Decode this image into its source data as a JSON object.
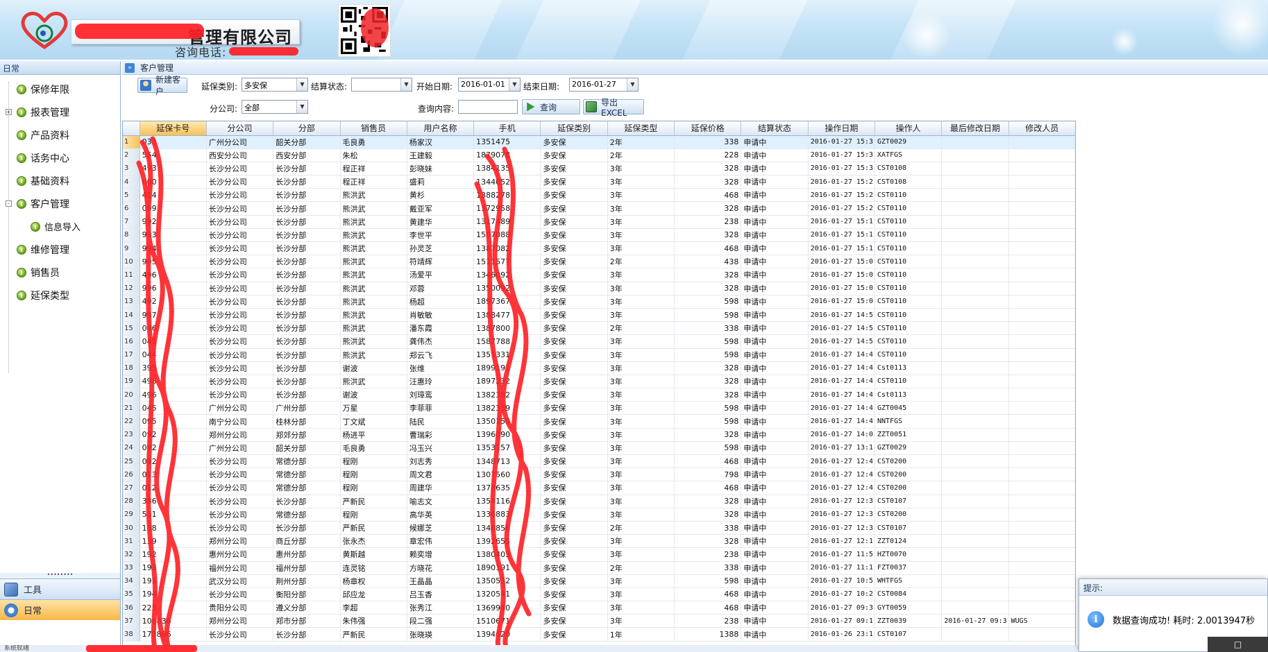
{
  "banner": {
    "company_name": "管理有限公司",
    "hotline_label": "咨询电话:"
  },
  "sidebar": {
    "header": "日常",
    "items": [
      {
        "label": "保修年限",
        "child": false,
        "expander": ""
      },
      {
        "label": "报表管理",
        "child": false,
        "expander": "+"
      },
      {
        "label": "产品资料",
        "child": false,
        "expander": ""
      },
      {
        "label": "话务中心",
        "child": false,
        "expander": ""
      },
      {
        "label": "基础资料",
        "child": false,
        "expander": ""
      },
      {
        "label": "客户管理",
        "child": false,
        "expander": "-"
      },
      {
        "label": "信息导入",
        "child": true,
        "expander": ""
      },
      {
        "label": "维修管理",
        "child": false,
        "expander": ""
      },
      {
        "label": "销售员",
        "child": false,
        "expander": ""
      },
      {
        "label": "延保类型",
        "child": false,
        "expander": ""
      }
    ],
    "grip": "••••••••",
    "tools_label": "工具",
    "daily_label": "日常"
  },
  "breadcrumb": {
    "title": "客户管理",
    "icon": "»"
  },
  "filters": {
    "new_customer_label": "新建客户",
    "ext_type_label": "延保类别:",
    "ext_type_value": "多安保",
    "settle_label": "结算状态:",
    "settle_value": "",
    "start_label": "开始日期:",
    "start_value": "2016-01-01",
    "end_label": "结束日期:",
    "end_value": "2016-01-27",
    "branch_label": "分公司:",
    "branch_value": "全部",
    "query_label": "查询内容:",
    "query_value": "",
    "search_label": "查询",
    "export_label": "导出EXCEL"
  },
  "grid": {
    "columns": [
      "延保卡号",
      "分公司",
      "分部",
      "销售员",
      "用户名称",
      "手机",
      "延保类别",
      "延保类型",
      "延保价格",
      "结算状态",
      "操作日期",
      "操作人",
      "最后修改日期",
      "修改人员"
    ],
    "rows": [
      [
        "1",
        "033",
        "广州分公司",
        "韶关分部",
        "毛良勇",
        "杨家汉",
        "1351475",
        "多安保",
        "2年",
        "338",
        "申请中",
        "2016-01-27 15:3",
        "GZT0029",
        "",
        ""
      ],
      [
        "2",
        "554",
        "西安分公司",
        "西安分部",
        "朱松",
        "王建毅",
        "1879078",
        "多安保",
        "2年",
        "228",
        "申请中",
        "2016-01-27 15:3",
        "XATFGS",
        "",
        ""
      ],
      [
        "3",
        "493",
        "长沙分公司",
        "长沙分部",
        "程正祥",
        "彭晓妹",
        "1384135",
        "多安保",
        "3年",
        "328",
        "申请中",
        "2016-01-27 15:3",
        "CST0108",
        "",
        ""
      ],
      [
        "4",
        "000",
        "长沙分公司",
        "长沙分部",
        "程正祥",
        "盛莉",
        "1344052",
        "多安保",
        "3年",
        "328",
        "申请中",
        "2016-01-27 15:2",
        "CST0108",
        "",
        ""
      ],
      [
        "5",
        "414",
        "长沙分公司",
        "长沙分部",
        "熊洪武",
        "黄杉",
        "1388278",
        "多安保",
        "3年",
        "468",
        "申请中",
        "2016-01-27 15:2",
        "CST0110",
        "",
        ""
      ],
      [
        "6",
        "099",
        "长沙分公司",
        "长沙分部",
        "熊洪武",
        "戴亚军",
        "1372958",
        "多安保",
        "3年",
        "328",
        "申请中",
        "2016-01-27 15:2",
        "CST0110",
        "",
        ""
      ],
      [
        "7",
        "992",
        "长沙分公司",
        "长沙分部",
        "熊洪武",
        "黄建华",
        "1317489",
        "多安保",
        "3年",
        "238",
        "申请中",
        "2016-01-27 15:1",
        "CST0110",
        "",
        ""
      ],
      [
        "8",
        "993",
        "长沙分公司",
        "长沙分部",
        "熊洪武",
        "李世平",
        "1507088",
        "多安保",
        "3年",
        "328",
        "申请中",
        "2016-01-27 15:1",
        "CST0110",
        "",
        ""
      ],
      [
        "9",
        "994",
        "长沙分公司",
        "长沙分部",
        "熊洪武",
        "孙灵芝",
        "1387082",
        "多安保",
        "3年",
        "468",
        "申请中",
        "2016-01-27 15:1",
        "CST0110",
        "",
        ""
      ],
      [
        "10",
        "995",
        "长沙分公司",
        "长沙分部",
        "熊洪武",
        "符靖辉",
        "1511577",
        "多安保",
        "2年",
        "438",
        "申请中",
        "2016-01-27 15:0",
        "CST0110",
        "",
        ""
      ],
      [
        "11",
        "496",
        "长沙分公司",
        "长沙分部",
        "熊洪武",
        "汤爱平",
        "1346092",
        "多安保",
        "3年",
        "328",
        "申请中",
        "2016-01-27 15:0",
        "CST0110",
        "",
        ""
      ],
      [
        "12",
        "996",
        "长沙分公司",
        "长沙分部",
        "熊洪武",
        "邓蓉",
        "1350092",
        "多安保",
        "3年",
        "328",
        "申请中",
        "2016-01-27 15:0",
        "CST0110",
        "",
        ""
      ],
      [
        "13",
        "492",
        "长沙分公司",
        "长沙分部",
        "熊洪武",
        "杨超",
        "1897367",
        "多安保",
        "3年",
        "598",
        "申请中",
        "2016-01-27 15:0",
        "CST0110",
        "",
        ""
      ],
      [
        "14",
        "997",
        "长沙分公司",
        "长沙分部",
        "熊洪武",
        "肖敏敏",
        "1388477",
        "多安保",
        "3年",
        "598",
        "申请中",
        "2016-01-27 14:5",
        "CST0110",
        "",
        ""
      ],
      [
        "15",
        "046",
        "长沙分公司",
        "长沙分部",
        "熊洪武",
        "潘东霞",
        "1387800",
        "多安保",
        "2年",
        "338",
        "申请中",
        "2016-01-27 14:5",
        "CST0110",
        "",
        ""
      ],
      [
        "16",
        "045",
        "长沙分公司",
        "长沙分部",
        "熊洪武",
        "龚伟杰",
        "1587788",
        "多安保",
        "3年",
        "598",
        "申请中",
        "2016-01-27 14:5",
        "CST0110",
        "",
        ""
      ],
      [
        "17",
        "044",
        "长沙分公司",
        "长沙分部",
        "熊洪武",
        "郑云飞",
        "1351331",
        "多安保",
        "3年",
        "598",
        "申请中",
        "2016-01-27 14:4",
        "CST0110",
        "",
        ""
      ],
      [
        "18",
        "395",
        "长沙分公司",
        "长沙分部",
        "谢波",
        "张维",
        "1899191",
        "多安保",
        "3年",
        "328",
        "申请中",
        "2016-01-27 14:4",
        "Cst0113",
        "",
        ""
      ],
      [
        "19",
        "498",
        "长沙分公司",
        "长沙分部",
        "熊洪武",
        "汪惠玲",
        "1897232",
        "多安保",
        "3年",
        "328",
        "申请中",
        "2016-01-27 14:4",
        "CST0110",
        "",
        ""
      ],
      [
        "20",
        "496",
        "长沙分公司",
        "长沙分部",
        "谢波",
        "刘璋鸾",
        "1382382",
        "多安保",
        "3年",
        "328",
        "申请中",
        "2016-01-27 14:4",
        "Cst0113",
        "",
        ""
      ],
      [
        "21",
        "045",
        "广州分公司",
        "广州分部",
        "万星",
        "李菲菲",
        "1382339",
        "多安保",
        "3年",
        "598",
        "申请中",
        "2016-01-27 14:4",
        "GZT0045",
        "",
        ""
      ],
      [
        "22",
        "095",
        "南宁分公司",
        "桂林分部",
        "丁文斌",
        "陆民",
        "1350159",
        "多安保",
        "3年",
        "598",
        "申请中",
        "2016-01-27 14:4",
        "NNTFGS",
        "",
        ""
      ],
      [
        "23",
        "092",
        "郑州分公司",
        "郑郊分部",
        "杨进平",
        "曹瑞彩",
        "1396090",
        "多安保",
        "3年",
        "328",
        "申请中",
        "2016-01-27 14:0",
        "ZZT0051",
        "",
        ""
      ],
      [
        "24",
        "092",
        "广州分公司",
        "韶关分部",
        "毛良勇",
        "冯玉兴",
        "1353157",
        "多安保",
        "3年",
        "598",
        "申请中",
        "2016-01-27 13:1",
        "GZT0029",
        "",
        ""
      ],
      [
        "25",
        "092",
        "长沙分公司",
        "常德分部",
        "程刚",
        "刘志秀",
        "1348713",
        "多安保",
        "3年",
        "468",
        "申请中",
        "2016-01-27 12:4",
        "CST0200",
        "",
        ""
      ],
      [
        "26",
        "013",
        "长沙分公司",
        "常德分部",
        "程刚",
        "周文君",
        "1307560",
        "多安保",
        "3年",
        "798",
        "申请中",
        "2016-01-27 12:4",
        "CST0200",
        "",
        ""
      ],
      [
        "27",
        "012",
        "长沙分公司",
        "常德分部",
        "程刚",
        "周建华",
        "1378635",
        "多安保",
        "3年",
        "468",
        "申请中",
        "2016-01-27 12:4",
        "CST0200",
        "",
        ""
      ],
      [
        "28",
        "386",
        "长沙分公司",
        "长沙分部",
        "严新民",
        "喻志文",
        "1354116",
        "多安保",
        "3年",
        "328",
        "申请中",
        "2016-01-27 12:3",
        "CST0107",
        "",
        ""
      ],
      [
        "29",
        "531",
        "长沙分公司",
        "常德分部",
        "程刚",
        "高华英",
        "1336883",
        "多安保",
        "3年",
        "328",
        "申请中",
        "2016-01-27 12:3",
        "CST0200",
        "",
        ""
      ],
      [
        "30",
        "138",
        "长沙分公司",
        "长沙分部",
        "严新民",
        "候娜芝",
        "1348856",
        "多安保",
        "2年",
        "338",
        "申请中",
        "2016-01-27 12:3",
        "CST0107",
        "",
        ""
      ],
      [
        "31",
        "139",
        "郑州分公司",
        "商丘分部",
        "张永杰",
        "章宏伟",
        "1392655",
        "多安保",
        "3年",
        "328",
        "申请中",
        "2016-01-27 12:1",
        "ZZT0124",
        "",
        ""
      ],
      [
        "32",
        "192",
        "惠州分公司",
        "惠州分部",
        "黄斯越",
        "赖奕增",
        "1380403",
        "多安保",
        "3年",
        "238",
        "申请中",
        "2016-01-27 11:5",
        "HZT0070",
        "",
        ""
      ],
      [
        "33",
        "193",
        "福州分公司",
        "福州分部",
        "连灵铭",
        "方晓花",
        "1890191",
        "多安保",
        "2年",
        "338",
        "申请中",
        "2016-01-27 11:1",
        "FZT0037",
        "",
        ""
      ],
      [
        "34",
        "195",
        "武汉分公司",
        "荆州分部",
        "杨章权",
        "王晶晶",
        "1350532",
        "多安保",
        "3年",
        "598",
        "申请中",
        "2016-01-27 10:5",
        "WHTFGS",
        "",
        ""
      ],
      [
        "35",
        "194",
        "长沙分公司",
        "衡阳分部",
        "邱应龙",
        "吕玉香",
        "1320541",
        "多安保",
        "3年",
        "468",
        "申请中",
        "2016-01-27 10:2",
        "CST0084",
        "",
        ""
      ],
      [
        "36",
        "223",
        "贵阳分公司",
        "遵义分部",
        "李超",
        "张秀江",
        "1369940",
        "多安保",
        "3年",
        "468",
        "申请中",
        "2016-01-27 09:3",
        "GYT0059",
        "",
        ""
      ],
      [
        "37",
        "106836",
        "郑州分公司",
        "郑市分部",
        "朱伟强",
        "段二强",
        "1510671",
        "多安保",
        "3年",
        "238",
        "申请中",
        "2016-01-27 09:1",
        "ZZT0039",
        "2016-01-27 09:3",
        "WUGS"
      ],
      [
        "38",
        "175886",
        "长沙分公司",
        "长沙分部",
        "严新民",
        "张晓瑛",
        "1394620",
        "多安保",
        "1年",
        "1388",
        "申请中",
        "2016-01-26 23:1",
        "CST0107",
        "",
        ""
      ]
    ]
  },
  "toast": {
    "title": "提示:",
    "message": "数据查询成功! 耗时: 2.0013947秒",
    "icon": "i"
  },
  "statusbar": {
    "text": "系统就绪"
  },
  "corner_button": {
    "label": "□"
  },
  "colors": {
    "accent": "#3f86d6",
    "redaction": "#ff1e24",
    "selected_row": "#dff0ff"
  }
}
